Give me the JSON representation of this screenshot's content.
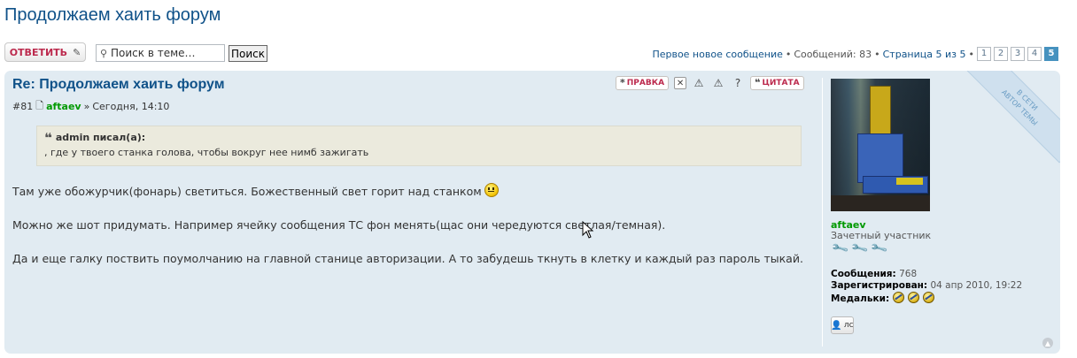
{
  "topic": {
    "title": "Продолжаем хаить форум"
  },
  "action_bar": {
    "reply_label": "ОТВЕТИТЬ",
    "search_placeholder": "Поиск в теме…",
    "search_button": "Поиск",
    "pagination": {
      "first_new": "Первое новое сообщение",
      "posts_count": "Сообщений: 83",
      "page_info": "Страница 5 из 5",
      "pages": [
        "1",
        "2",
        "3",
        "4",
        "5"
      ],
      "active_page": "5"
    }
  },
  "post": {
    "title": "Re: Продолжаем хаить форум",
    "number": "#81",
    "author": "aftaev",
    "time": "Сегодня, 14:10",
    "buttons": {
      "edit": "ПРАВКА",
      "quote": "ЦИТАТА"
    },
    "quote": {
      "author_line": "admin писал(а):",
      "text": ", где у твоего станка голова, чтобы вокруг нее нимб зажигать"
    },
    "paragraphs": [
      "Там уже обожурчик(фонарь) светиться. Божественный свет горит над станком",
      "Можно же шот придумать. Например ячейку сообщения ТС фон менять(щас они чередуются светлая/темная).",
      "Да и еще галку поствить поумолчанию на главной станице авторизации. А то забудешь ткнуть в клетку и каждый раз пароль тыкай."
    ]
  },
  "profile": {
    "ribbon_line1": "В СЕТИ",
    "ribbon_line2": "АВТОР ТЕМЫ",
    "username": "aftaev",
    "rank": "Зачетный участник",
    "posts_label": "Сообщения:",
    "posts_value": "768",
    "registered_label": "Зарегистрирован:",
    "registered_value": "04 апр 2010, 19:22",
    "medals_label": "Медальки:",
    "pm_label": "лс"
  },
  "colors": {
    "link": "#105289",
    "author": "#009900",
    "post_bg": "#e1ebf2",
    "button_red": "#bc2a4d"
  }
}
